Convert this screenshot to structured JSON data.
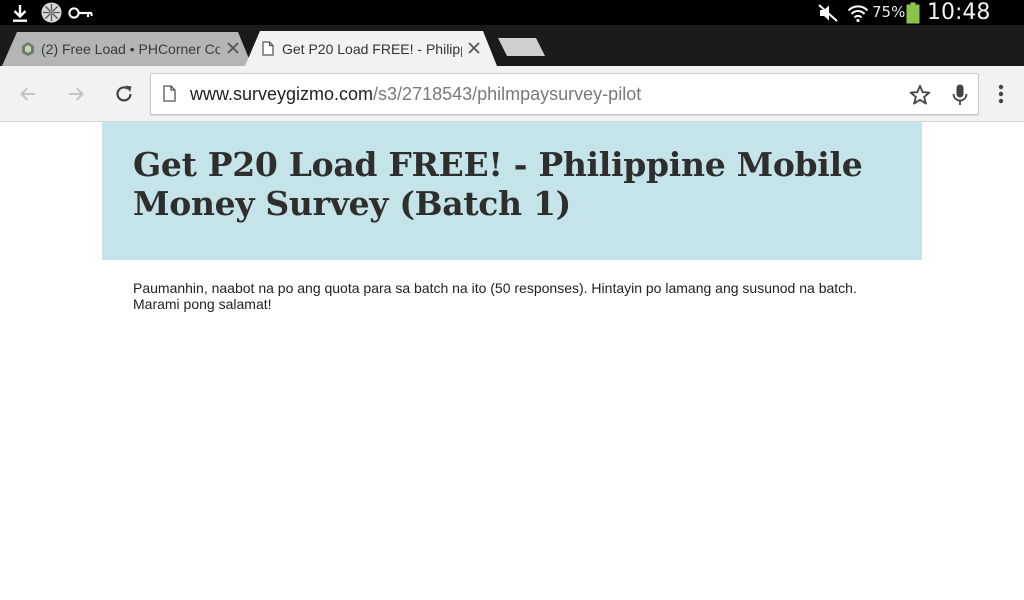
{
  "status_bar": {
    "left_icons": [
      "download-icon",
      "snowflake-icon",
      "key-icon"
    ],
    "right_icons": [
      "mute-icon",
      "wifi-icon",
      "battery-icon"
    ],
    "battery_percent": "75%",
    "clock": "10:48 PM"
  },
  "tabs": [
    {
      "title": "(2) Free Load • PHCorner Co",
      "icon": "phcorner-favicon-icon",
      "active": false
    },
    {
      "title": "Get P20 Load FREE! - Philipp",
      "icon": "page-icon",
      "active": true
    }
  ],
  "toolbar": {
    "back_icon": "back-arrow-icon",
    "forward_icon": "forward-arrow-icon",
    "reload_icon": "reload-icon",
    "menu_icon": "overflow-menu-icon"
  },
  "omnibox": {
    "url_host": "www.surveygizmo.com",
    "url_path": "/s3/2718543/philmpaysurvey-pilot",
    "page_icon": "page-icon",
    "bookmark_icon": "star-icon",
    "voice_icon": "microphone-icon"
  },
  "survey": {
    "title": "Get P20 Load FREE! - Philippine Mobile Money Survey (Batch 1)",
    "message": "Paumanhin, naabot na po ang quota para sa batch na ito (50 responses). Hintayin po lamang ang susunod na batch. Marami pong salamat!"
  },
  "colors": {
    "header_background": "#c5e4e9",
    "status_bar": "#000000",
    "tab_strip": "#1a1a1a",
    "active_tab": "#f2f2f2",
    "battery_fill": "#8bc34a"
  }
}
